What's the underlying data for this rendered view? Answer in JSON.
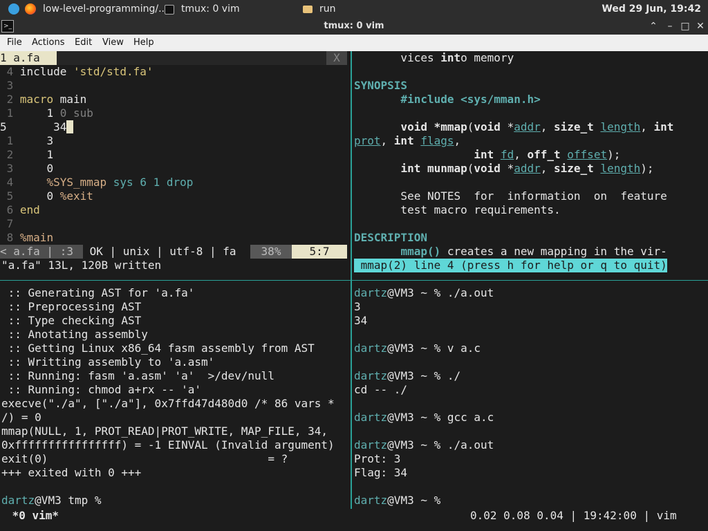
{
  "panel": {
    "tasks": [
      "low-level-programming/...",
      "tmux: 0 vim",
      "run"
    ],
    "clock": "Wed 29 Jun, 19:42"
  },
  "window": {
    "title": "tmux: 0 vim"
  },
  "menu": [
    "File",
    "Actions",
    "Edit",
    "View",
    "Help"
  ],
  "vim": {
    "tab_label": "1 a.fa",
    "tab_close": "X",
    "lines": [
      {
        "n": "4",
        "t": "include 'std/std.fa'"
      },
      {
        "n": "3",
        "t": ""
      },
      {
        "n": "2",
        "t": "macro main"
      },
      {
        "n": "1",
        "t": "    1 0 sub"
      },
      {
        "n": "5",
        "t": "    34"
      },
      {
        "n": "1",
        "t": "    3"
      },
      {
        "n": "2",
        "t": "    1"
      },
      {
        "n": "3",
        "t": "    0"
      },
      {
        "n": "4",
        "t": "    %SYS_mmap sys 6 1 drop"
      },
      {
        "n": "5",
        "t": "    0 %exit"
      },
      {
        "n": "6",
        "t": "end"
      },
      {
        "n": "7",
        "t": ""
      },
      {
        "n": "8",
        "t": "%main"
      }
    ],
    "status_left": "< a.fa | :3",
    "status_mid": " OK | unix | utf-8 | fa ",
    "status_pct": "38%",
    "status_pos": "5:7",
    "message": "\"a.fa\" 13L, 120B written"
  },
  "man": {
    "lines": [
      "       vices into memory",
      "",
      "SYNOPSIS",
      "       #include <sys/mman.h>",
      "",
      "       void *mmap(void *addr, size_t length, int",
      "prot, int flags,",
      "                  int fd, off_t offset);",
      "       int munmap(void *addr, size_t length);",
      "",
      "       See NOTES  for  information  on  feature",
      "       test macro requirements.",
      "",
      "DESCRIPTION",
      "       mmap() creates a new mapping in the vir-"
    ],
    "status": " mmap(2) line 4 (press h for help or q to quit)"
  },
  "build": {
    "lines": [
      " :: Generating AST for 'a.fa'",
      " :: Preprocessing AST",
      " :: Type checking AST",
      " :: Anotating assembly",
      " :: Getting Linux x86_64 fasm assembly from AST",
      " :: Writting assembly to 'a.asm'",
      " :: Running: fasm 'a.asm' 'a'  >/dev/null",
      " :: Running: chmod a+rx -- 'a'",
      "execve(\"./a\", [\"./a\"], 0x7ffd47d480d0 /* 86 vars *",
      "/) = 0",
      "mmap(NULL, 1, PROT_READ|PROT_WRITE, MAP_FILE, 34,",
      "0xffffffffffffffff) = -1 EINVAL (Invalid argument)",
      "exit(0)                                 = ?",
      "+++ exited with 0 +++",
      ""
    ],
    "prompt_user": "dartz",
    "prompt_rest": "@VM3 tmp % "
  },
  "shell": {
    "entries": [
      {
        "type": "prompt",
        "cmd": "./a.out"
      },
      {
        "type": "out",
        "text": "3"
      },
      {
        "type": "out",
        "text": "34"
      },
      {
        "type": "out",
        "text": ""
      },
      {
        "type": "prompt",
        "cmd": "v a.c"
      },
      {
        "type": "out",
        "text": ""
      },
      {
        "type": "prompt",
        "cmd": "./"
      },
      {
        "type": "out",
        "text": "cd -- ./"
      },
      {
        "type": "out",
        "text": ""
      },
      {
        "type": "prompt",
        "cmd": "gcc a.c"
      },
      {
        "type": "out",
        "text": ""
      },
      {
        "type": "prompt",
        "cmd": "./a.out"
      },
      {
        "type": "out",
        "text": "Prot: 3"
      },
      {
        "type": "out",
        "text": "Flag: 34"
      },
      {
        "type": "out",
        "text": ""
      },
      {
        "type": "prompt",
        "cmd": ""
      }
    ],
    "user": "dartz",
    "host": "@VM3 ~ % "
  },
  "tmux": {
    "left": " *0 vim*",
    "right": "0.02 0.08 0.04 | 19:42:00 | vim "
  },
  "colors": {
    "accent": "#5fafaf",
    "divider": "#2aa198",
    "status_bg": "#e8e4c8"
  }
}
